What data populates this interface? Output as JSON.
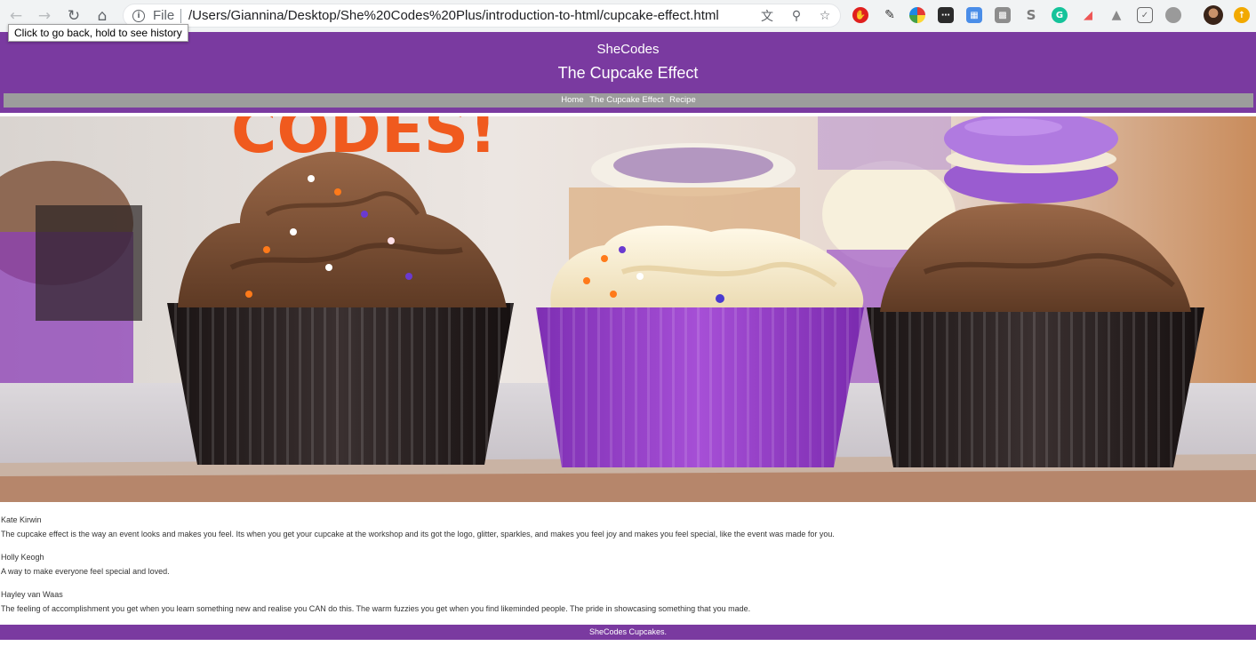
{
  "browser": {
    "scheme_label": "File",
    "url": "/Users/Giannina/Desktop/She%20Codes%20Plus/introduction-to-html/cupcake-effect.html",
    "tooltip": "Click to go back, hold to see history"
  },
  "header": {
    "brand": "SheCodes",
    "title": "The Cupcake Effect"
  },
  "nav": {
    "items": [
      {
        "label": "Home"
      },
      {
        "label": "The Cupcake Effect"
      },
      {
        "label": "Recipe"
      }
    ]
  },
  "hero": {
    "alt": "Cupcakes with chocolate and vanilla frosting in purple and black liners",
    "sign_text": "CODES!"
  },
  "quotes": [
    {
      "author": "Kate Kirwin",
      "text": "The cupcake effect is the way an event looks and makes you feel. Its when you get your cupcake at the workshop and its got the logo, glitter, sparkles, and makes you feel joy and makes you feel special, like the event was made for you."
    },
    {
      "author": "Holly Keogh",
      "text": "A way to make everyone feel special and loved."
    },
    {
      "author": "Hayley van Waas",
      "text": "The feeling of accomplishment you get when you learn something new and realise you CAN do this. The warm fuzzies you get when you find likeminded people. The pride in showcasing something that you made."
    }
  ],
  "footer": {
    "text": "SheCodes Cupcakes."
  },
  "colors": {
    "brand_purple": "#7a3aa0",
    "nav_gray": "#9c9c9c"
  }
}
